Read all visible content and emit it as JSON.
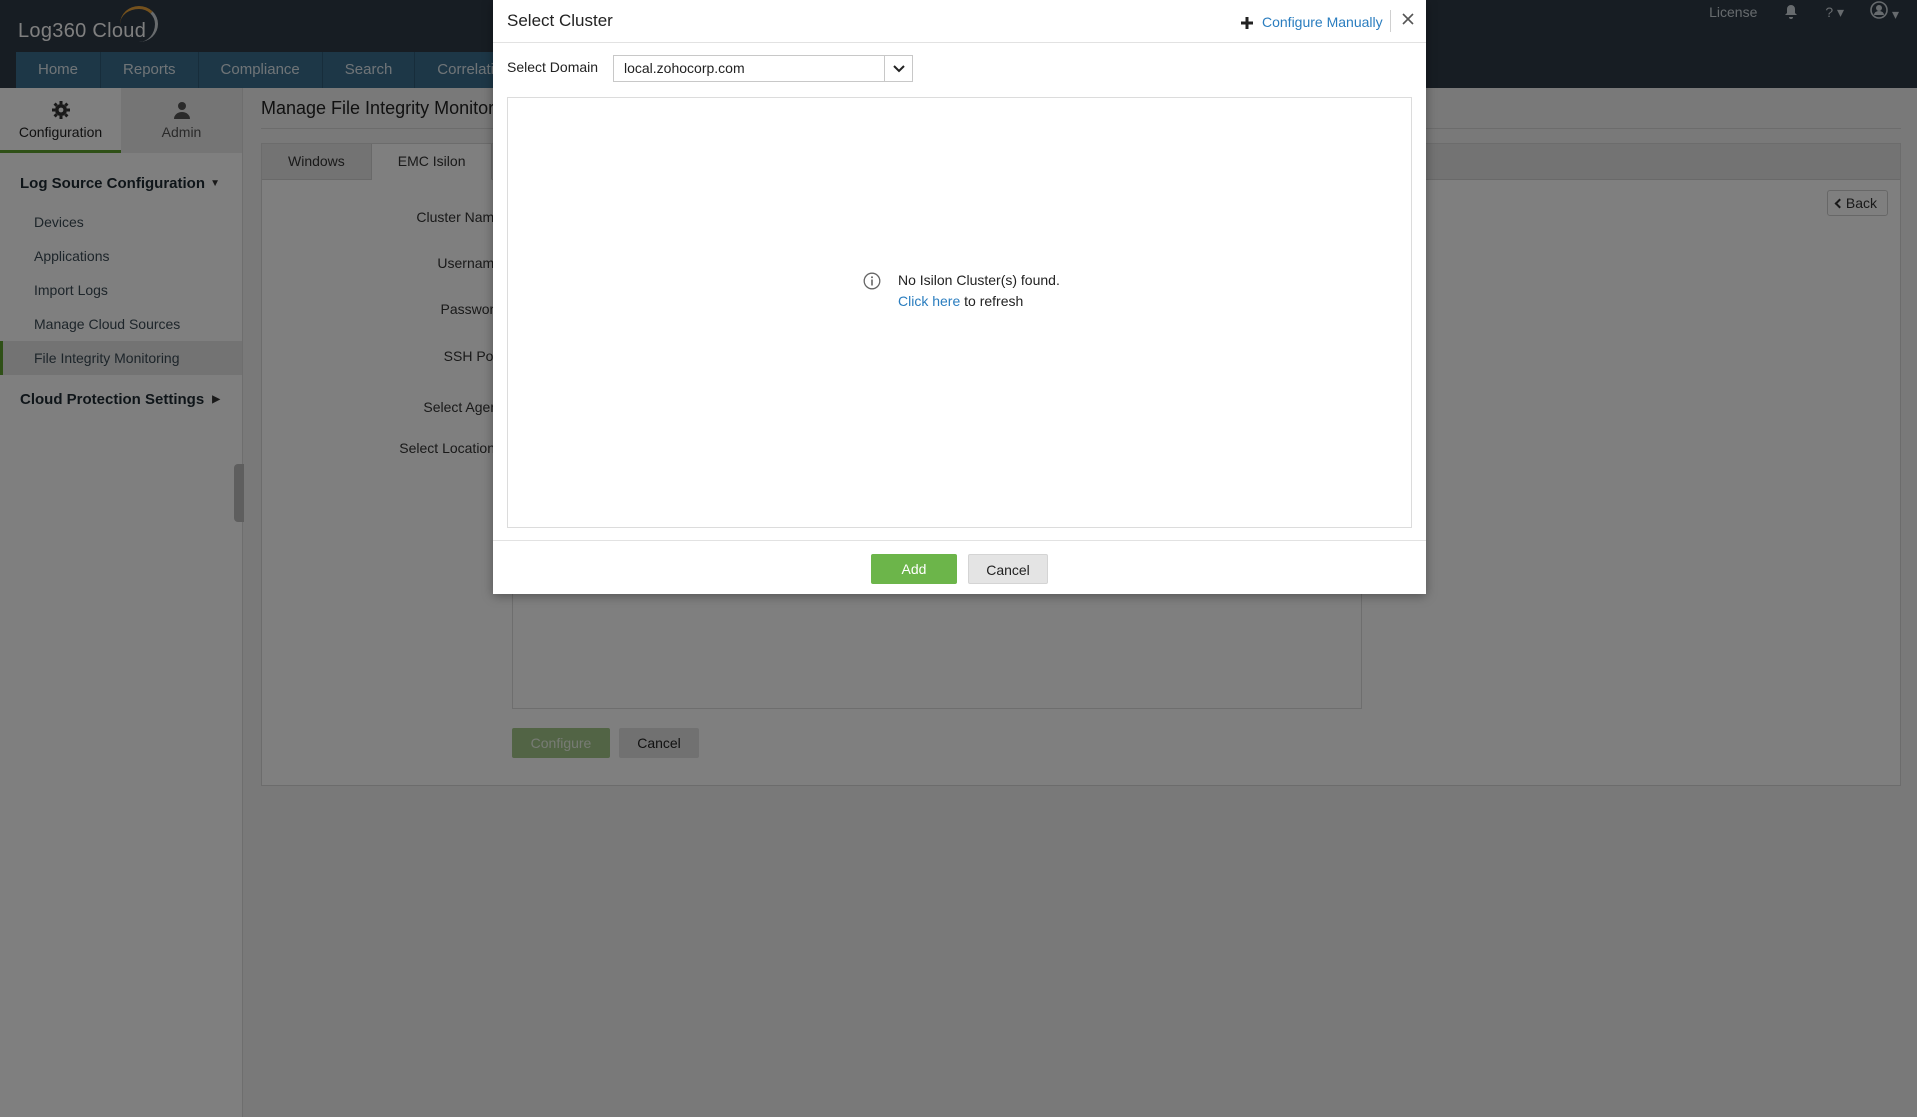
{
  "app": {
    "logo_text": "Log360 Cloud"
  },
  "top_nav": [
    "Home",
    "Reports",
    "Compliance",
    "Search",
    "Correlati"
  ],
  "top_right": {
    "license": "License",
    "help": "?"
  },
  "side_tabs": [
    {
      "label": "Configuration",
      "icon": "gear-icon",
      "active": true
    },
    {
      "label": "Admin",
      "icon": "user-icon",
      "active": false
    }
  ],
  "sidebar": {
    "group1": "Log Source Configuration",
    "items": [
      "Devices",
      "Applications",
      "Import Logs",
      "Manage Cloud Sources",
      "File Integrity Monitoring"
    ],
    "active_item": "File Integrity Monitoring",
    "group2": "Cloud Protection Settings"
  },
  "main": {
    "title": "Manage File Integrity Monitor",
    "tabs": [
      "Windows",
      "EMC Isilon"
    ],
    "active_tab": "EMC Isilon",
    "back": "Back",
    "form_labels": [
      "Cluster Name",
      "Username",
      "Password",
      "SSH Port",
      "Select Agent",
      "Select Locations"
    ],
    "configure_label": "Configure",
    "cancel_label": "Cancel"
  },
  "modal": {
    "title": "Select Cluster",
    "configure_manually": "Configure Manually",
    "domain_label": "Select Domain",
    "domain_value": "local.zohocorp.com",
    "empty_message": "No Isilon Cluster(s) found.",
    "refresh_link": "Click here",
    "refresh_suffix": " to refresh",
    "add_label": "Add",
    "cancel_label": "Cancel"
  },
  "colors": {
    "accent_green": "#6cb54a",
    "link_blue": "#2a7dbf",
    "nav_blue": "#3b6f8f",
    "header_dark": "#2e3b47"
  }
}
